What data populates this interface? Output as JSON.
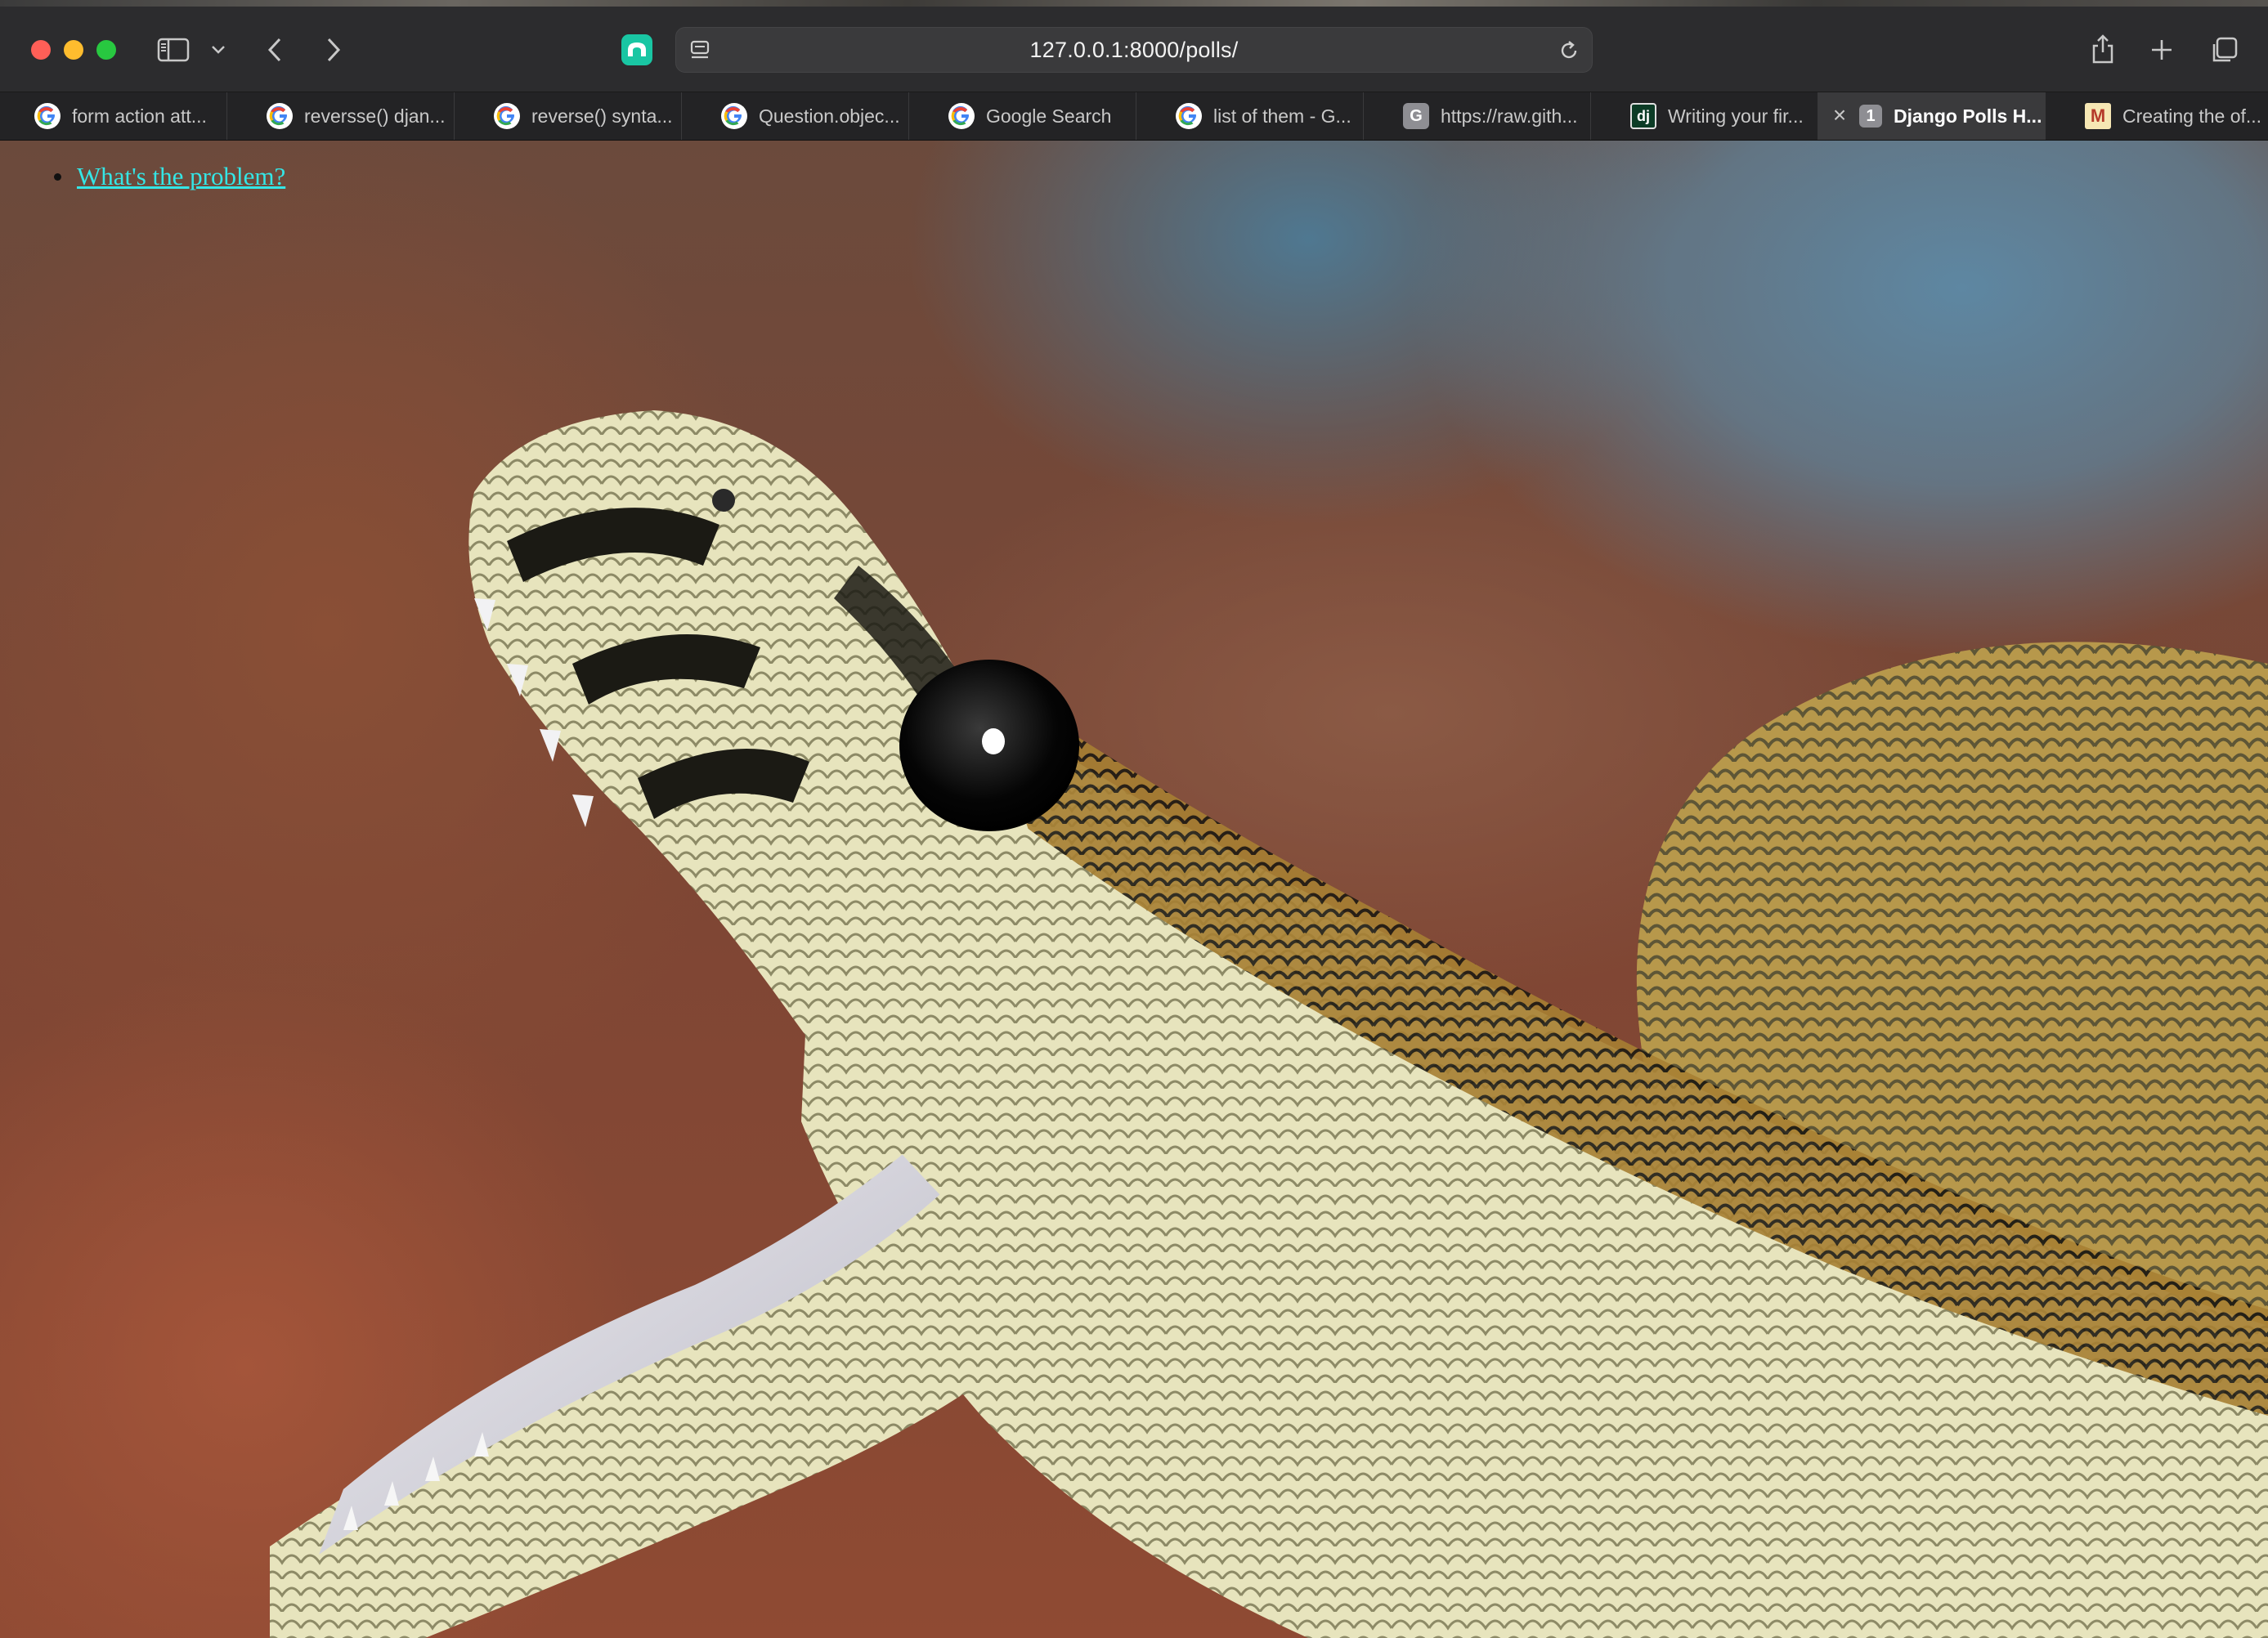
{
  "browser": {
    "url": "127.0.0.1:8000/polls/",
    "tabs": [
      {
        "label": "form action att...",
        "favicon": "google-icon",
        "active": false
      },
      {
        "label": "reversse() djan...",
        "favicon": "google-icon",
        "active": false
      },
      {
        "label": "reverse() synta...",
        "favicon": "google-icon",
        "active": false
      },
      {
        "label": "Question.objec...",
        "favicon": "google-icon",
        "active": false
      },
      {
        "label": "Google Search",
        "favicon": "google-icon",
        "active": false
      },
      {
        "label": "list of them - G...",
        "favicon": "google-icon",
        "active": false
      },
      {
        "label": "https://raw.gith...",
        "favicon": "github-raw-icon",
        "favicon_text": "G",
        "active": false
      },
      {
        "label": "Writing your fir...",
        "favicon": "django-icon",
        "favicon_text": "dj",
        "active": false
      },
      {
        "label": "Django Polls H...",
        "favicon": "tab-number-icon",
        "favicon_text": "1",
        "active": true
      },
      {
        "label": "Creating the of...",
        "favicon": "medium-icon",
        "favicon_text": "M",
        "active": false
      }
    ]
  },
  "page": {
    "links": [
      {
        "text": "What's the problem?"
      }
    ]
  },
  "colors": {
    "link": "#34e6e6",
    "toolbar": "#2c2c2e",
    "tabstrip": "#232325",
    "active_tab": "#3a3a3c",
    "extension_icon": "#19c6a3"
  }
}
